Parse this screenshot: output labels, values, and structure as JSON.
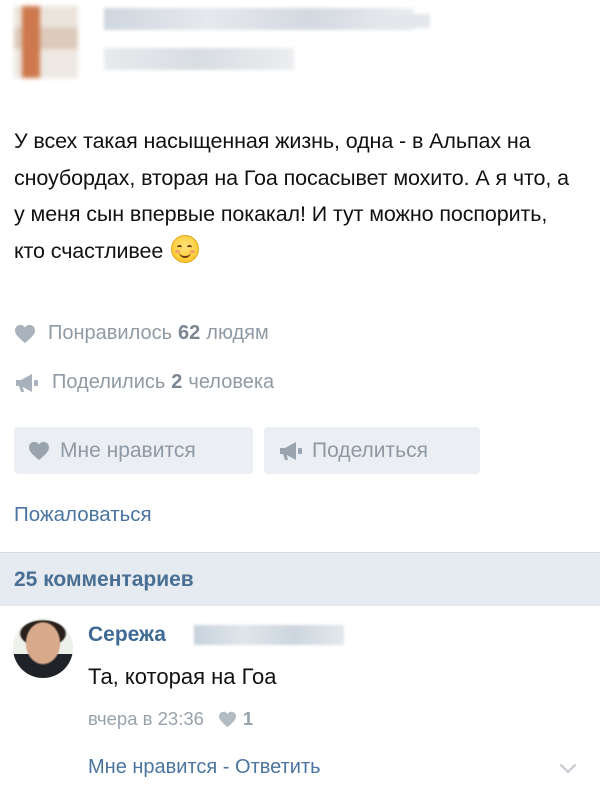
{
  "post": {
    "text_before_emoji": "У всех такая насыщенная жизнь, одна - в Альпах на сноубордах, вторая на Гоа посасывет мохито. А я что, а у меня сын впервые покакал! И тут можно поспорить, кто счастливее",
    "emoji": "smiling-face-icon"
  },
  "stats": {
    "likes_prefix": "Понравилось",
    "likes_count": "62",
    "likes_suffix": "людям",
    "shares_prefix": "Поделились",
    "shares_count": "2",
    "shares_suffix": "человека"
  },
  "actions": {
    "like_label": "Мне нравится",
    "share_label": "Поделиться",
    "report_label": "Пожаловаться"
  },
  "comments": {
    "header": "25 комментариев",
    "items": [
      {
        "author": "Сережа",
        "text": "Та, которая на Гоа",
        "time": "вчера в 23:36",
        "likes": "1",
        "like_action": "Мне нравится",
        "separator": " - ",
        "reply_action": "Ответить"
      }
    ]
  },
  "colors": {
    "link": "#4a75a0",
    "muted": "#909aa5",
    "button_bg": "#ebeef2",
    "comments_header_bg": "#e5ebf1"
  }
}
